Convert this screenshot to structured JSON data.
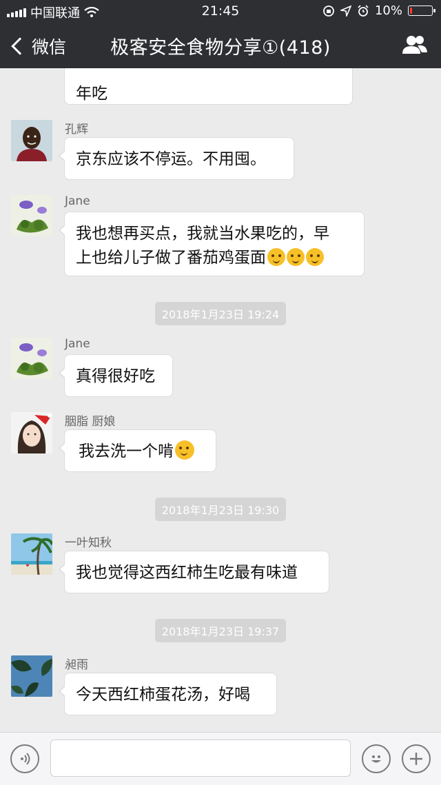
{
  "status_bar": {
    "carrier": "中国联通",
    "time": "21:45",
    "battery": "10%",
    "battery_level": 0.1
  },
  "nav": {
    "back_label": "微信",
    "title": "极客安全食物分享①(418)"
  },
  "messages": [
    {
      "type": "partial",
      "text_line2": "年吃"
    },
    {
      "type": "msg",
      "sender": "孔辉",
      "avatar": "boy-photo",
      "text": "京东应该不停运。不用囤。"
    },
    {
      "type": "msg",
      "sender": "Jane",
      "avatar": "morning-glory-flower",
      "line1": "我也想再买点，我就当水果吃的，早",
      "line2": "上也给儿子做了番茄鸡蛋面",
      "emojis": [
        "thinking-emoji",
        "thinking-emoji",
        "thinking-emoji"
      ]
    },
    {
      "type": "time",
      "text": "2018年1月23日 19:24"
    },
    {
      "type": "msg",
      "sender": "Jane",
      "avatar": "morning-glory-flower",
      "text": "真得很好吃"
    },
    {
      "type": "msg",
      "sender": "胭脂 厨娘",
      "avatar": "woman-santa-hat",
      "text": "我去洗一个啃",
      "emojis": [
        "blushing-emoji"
      ]
    },
    {
      "type": "time",
      "text": "2018年1月23日 19:30"
    },
    {
      "type": "msg",
      "sender": "一叶知秋",
      "avatar": "beach-palm",
      "text": "我也觉得这西红柿生吃最有味道"
    },
    {
      "type": "time",
      "text": "2018年1月23日 19:37"
    },
    {
      "type": "msg",
      "sender": "昶雨",
      "avatar": "leaves-sky",
      "text": "今天西红柿蛋花汤，好喝"
    }
  ],
  "input": {
    "placeholder": ""
  },
  "colors": {
    "header_bg": "#2e2f33",
    "chat_bg": "#ebebeb",
    "battery_low": "#ff3b30"
  }
}
